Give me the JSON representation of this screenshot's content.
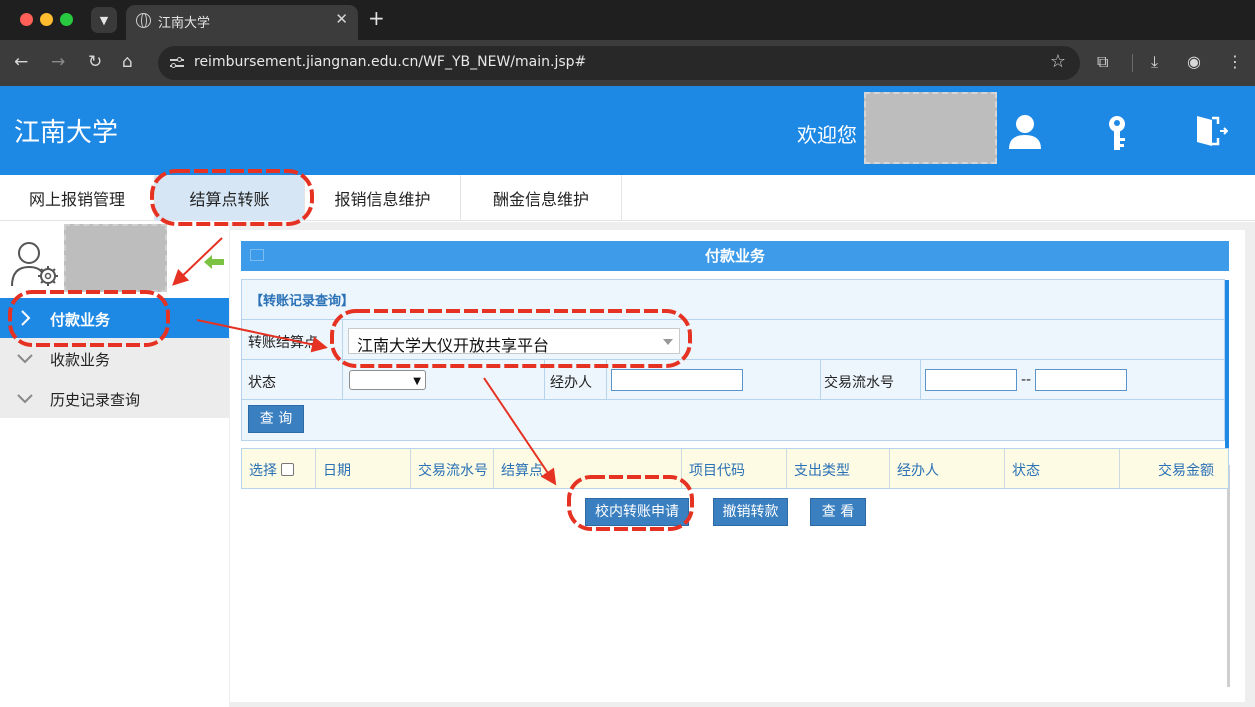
{
  "browser": {
    "tab_title": "江南大学",
    "tab_close": "✕",
    "new_tab": "+",
    "url": "reimbursement.jiangnan.edu.cn/WF_YB_NEW/main.jsp#"
  },
  "header": {
    "site_title": "江南大学",
    "welcome": "欢迎您"
  },
  "topnav": {
    "items": [
      {
        "label": "网上报销管理"
      },
      {
        "label": "结算点转账"
      },
      {
        "label": "报销信息维护"
      },
      {
        "label": "酬金信息维护"
      }
    ]
  },
  "sidebar": {
    "items": [
      {
        "label": "付款业务"
      },
      {
        "label": "收款业务"
      },
      {
        "label": "历史记录查询"
      }
    ]
  },
  "panel": {
    "title": "付款业务",
    "query_title": "【转账记录查询】",
    "settle_label": "转账结算点",
    "settle_value": "江南大学大仪开放共享平台",
    "status_label": "状态",
    "handler_label": "经办人",
    "serial_label": "交易流水号",
    "range_sep": "--",
    "query_button": "查 询"
  },
  "grid": {
    "columns": [
      {
        "label": "选择"
      },
      {
        "label": "日期"
      },
      {
        "label": "交易流水号"
      },
      {
        "label": "结算点"
      },
      {
        "label": "项目代码"
      },
      {
        "label": "支出类型"
      },
      {
        "label": "经办人"
      },
      {
        "label": "状态"
      },
      {
        "label": "交易金额"
      }
    ]
  },
  "actions": {
    "apply": "校内转账申请",
    "revoke": "撤销转款",
    "view": "查 看"
  },
  "colors": {
    "header_blue": "#1e88e5",
    "panel_blue": "#3d9be9",
    "button_blue": "#3a7fc0",
    "annotation_red": "#e53222"
  }
}
